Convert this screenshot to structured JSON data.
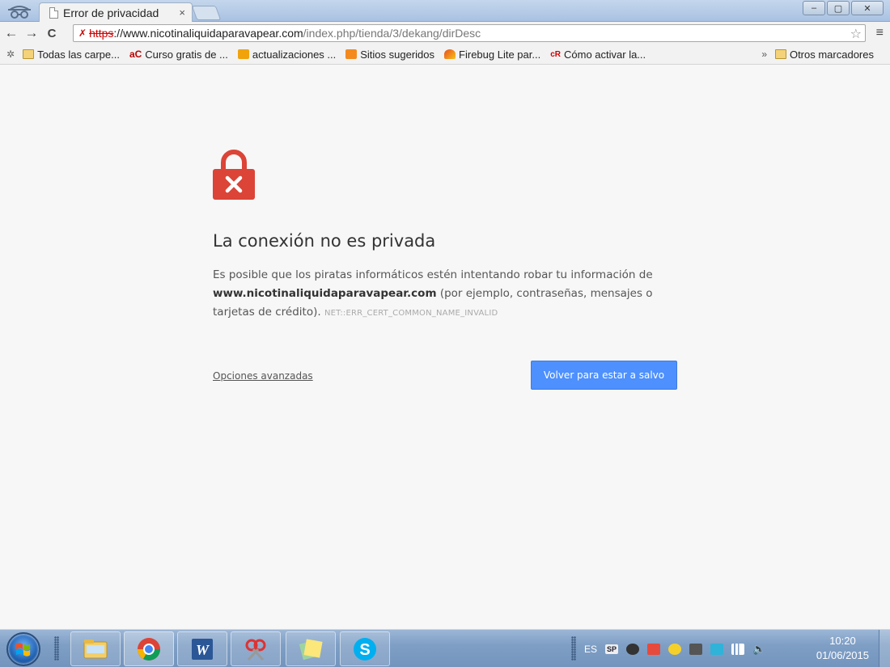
{
  "browser": {
    "tab_title": "Error de privacidad",
    "tab_close": "×",
    "win_minimize": "–",
    "win_maximize": "▢",
    "win_close": "✕"
  },
  "toolbar": {
    "back": "←",
    "forward": "→",
    "reload": "C",
    "url_scheme": "https",
    "url_host": "://www.nicotinaliquidaparavapear.com",
    "url_path": "/index.php/tienda/3/dekang/dirDesc",
    "star": "☆",
    "menu": "≡"
  },
  "bookmarks": {
    "apps_icon": "✲",
    "items": [
      {
        "label": "Todas las carpe...",
        "icon": "folder-icon"
      },
      {
        "label": "Curso gratis de ...",
        "icon": "ac-icon"
      },
      {
        "label": "actualizaciones ...",
        "icon": "bing-icon"
      },
      {
        "label": "Sitios sugeridos",
        "icon": "suggested-icon"
      },
      {
        "label": "Firebug Lite par...",
        "icon": "firebug-icon"
      },
      {
        "label": "Cómo activar la...",
        "icon": "cr-icon"
      }
    ],
    "overflow": "»",
    "other_label": "Otros marcadores"
  },
  "page": {
    "heading": "La conexión no es privada",
    "text_1": "Es posible que los piratas informáticos estén intentando robar tu información de",
    "domain": "www.nicotinaliquidaparavapear.com",
    "text_2": "(por ejemplo, contraseñas, mensajes o tarjetas de crédito).",
    "error_code": "NET::ERR_CERT_COMMON_NAME_INVALID",
    "advanced_link": "Opciones avanzadas",
    "safe_button": "Volver para estar a salvo"
  },
  "taskbar": {
    "language": "ES",
    "sp_label": "SP",
    "time": "10:20",
    "date": "01/06/2015"
  },
  "colors": {
    "accent_button": "#4d90fe",
    "padlock_red": "#db4437"
  }
}
